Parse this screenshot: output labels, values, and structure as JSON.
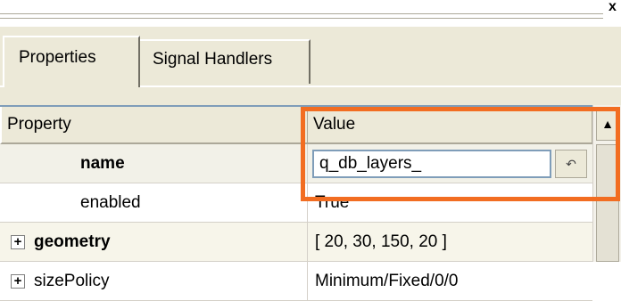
{
  "window": {
    "close_glyph": "x"
  },
  "tabs": [
    {
      "label": "Properties",
      "active": true
    },
    {
      "label": "Signal Handlers",
      "active": false
    }
  ],
  "grid": {
    "columns": [
      "Property",
      "Value"
    ],
    "rows": [
      {
        "property": "name",
        "value": "q_db_layers_",
        "bold": true,
        "expandable": false,
        "editing": true
      },
      {
        "property": "enabled",
        "value": "True",
        "bold": false,
        "expandable": false
      },
      {
        "property": "geometry",
        "value": "[ 20, 30, 150, 20 ]",
        "bold": true,
        "expandable": true
      },
      {
        "property": "sizePolicy",
        "value": "Minimum/Fixed/0/0",
        "bold": false,
        "expandable": true
      }
    ]
  },
  "icons": {
    "reset": "undo-arrow-icon",
    "expand": "plus-box-icon",
    "scroll_up": "triangle-up-icon"
  },
  "colors": {
    "highlight": "#f26d21",
    "selected_row": "#f2f1e8",
    "panel_bg": "#ece9d8",
    "grid_lines": "#d4d0c8"
  },
  "glyphs": {
    "expand": "+",
    "reset": "↶",
    "scroll_up": "▲"
  }
}
